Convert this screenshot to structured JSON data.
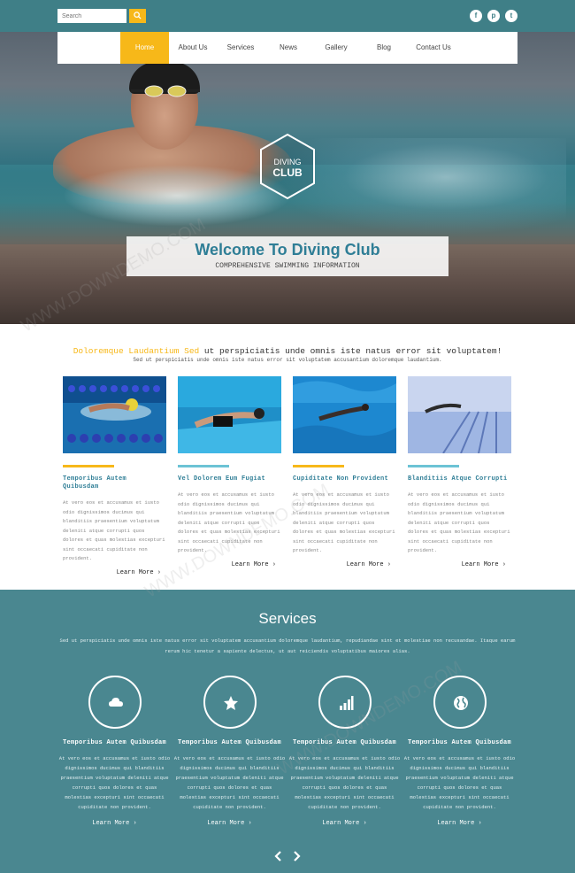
{
  "search": {
    "placeholder": "Search"
  },
  "social": [
    {
      "icon": "facebook-icon",
      "glyph": "f"
    },
    {
      "icon": "pinterest-icon",
      "glyph": "p"
    },
    {
      "icon": "twitter-icon",
      "glyph": "t"
    }
  ],
  "nav": {
    "items": [
      "Home",
      "About Us",
      "Services",
      "News",
      "Gallery",
      "Blog",
      "Contact Us"
    ],
    "active_index": 0
  },
  "logo": {
    "line1": "DIVING",
    "line2": "CLUB"
  },
  "hero": {
    "title": "Welcome To Diving Club",
    "subtitle": "COMPREHENSIVE SWIMMING INFORMATION"
  },
  "intro": {
    "highlight": "Doloremque Laudantium Sed",
    "title_rest": " ut perspiciatis unde omnis iste natus error sit voluptatem!",
    "subtitle": "Sed ut perspiciatis unde omnis iste natus error sit voluptatem accusantium doloremque laudantium."
  },
  "cards": [
    {
      "title": "Temporibus Autem Quibusdam",
      "text": "At vero eos et accusamus et iusto odio dignissimos ducimus qui blanditiis praesentium voluptatum deleniti atque corrupti quos dolores et quas molestias excepturi sint occaecati cupiditate non provident.",
      "more": "Learn More",
      "bar_color": "#f7b819"
    },
    {
      "title": "Vel Dolorem Eum Fugiat",
      "text": "At vero eos et accusamus et iusto odio dignissimos ducimus qui blanditiis praesentium voluptatum deleniti atque corrupti quos dolores et quas molestias excepturi sint occaecati cupiditate non provident.",
      "more": "Learn More",
      "bar_color": "#6cc3d5"
    },
    {
      "title": "Cupiditate Non Provident",
      "text": "At vero eos et accusamus et iusto odio dignissimos ducimus qui blanditiis praesentium voluptatum deleniti atque corrupti quos dolores et quas molestias excepturi sint occaecati cupiditate non provident.",
      "more": "Learn More",
      "bar_color": "#f7b819"
    },
    {
      "title": "Blanditiis Atque Corrupti",
      "text": "At vero eos et accusamus et iusto odio dignissimos ducimus qui blanditiis praesentium voluptatum deleniti atque corrupti quos dolores et quas molestias excepturi sint occaecati cupiditate non provident.",
      "more": "Learn More",
      "bar_color": "#6cc3d5"
    }
  ],
  "services": {
    "title": "Services",
    "description": "Sed ut perspiciatis unde omnis iste natus error sit voluptatem accusantium doloremque laudantium, repudiandae sint et molestiae non recusandae. Itaque earum rerum hic tenetur a sapiente delectus, ut aut reiciendis voluptatibus maiores alias.",
    "items": [
      {
        "icon": "cloud-icon",
        "title": "Temporibus Autem Quibusdam",
        "text": "At vero eos et accusamus et iusto odio dignissimos ducimus qui blanditiis praesentium voluptatum deleniti atque corrupti quos dolores et quas molestias excepturi sint occaecati cupiditate non provident.",
        "more": "Learn More"
      },
      {
        "icon": "star-icon",
        "title": "Temporibus Autem Quibusdam",
        "text": "At vero eos et accusamus et iusto odio dignissimos ducimus qui blanditiis praesentium voluptatum deleniti atque corrupti quos dolores et quas molestias excepturi sint occaecati cupiditate non provident.",
        "more": "Learn More"
      },
      {
        "icon": "bar-chart-icon",
        "title": "Temporibus Autem Quibusdam",
        "text": "At vero eos et accusamus et iusto odio dignissimos ducimus qui blanditiis praesentium voluptatum deleniti atque corrupti quos dolores et quas molestias excepturi sint occaecati cupiditate non provident.",
        "more": "Learn More"
      },
      {
        "icon": "globe-icon",
        "title": "Temporibus Autem Quibusdam",
        "text": "At vero eos et accusamus et iusto odio dignissimos ducimus qui blanditiis praesentium voluptatum deleniti atque corrupti quos dolores et quas molestias excepturi sint occaecati cupiditate non provident.",
        "more": "Learn More"
      }
    ]
  },
  "watermark": "WWW.DOWNDEMO.COM",
  "colors": {
    "teal": "#3f7f87",
    "services_bg": "#4a8790",
    "accent_yellow": "#f7b819",
    "accent_blue": "#6cc3d5",
    "title_blue": "#2f7e96"
  }
}
